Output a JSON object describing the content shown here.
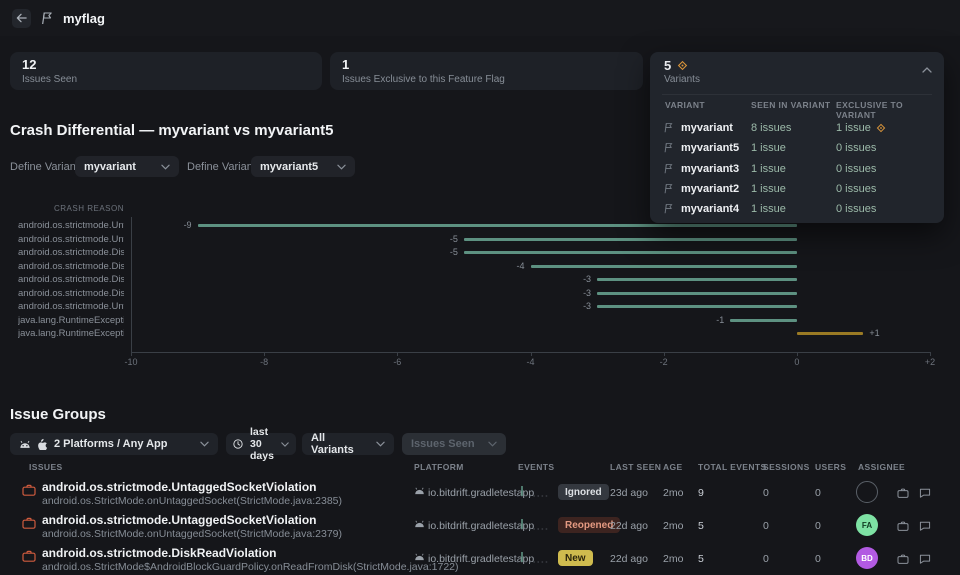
{
  "topbar": {
    "title": "myflag",
    "back_icon": "arrow-left-icon",
    "title_icon": "flag-icon"
  },
  "stat_cards": [
    {
      "value": "12",
      "label": "Issues Seen"
    },
    {
      "value": "1",
      "label": "Issues Exclusive to this Feature Flag"
    }
  ],
  "variants_panel": {
    "value": "5",
    "label": "Variants",
    "badge_icon": "diamond-icon",
    "collapse_icon": "chevron-up-icon",
    "columns": [
      "VARIANT",
      "SEEN IN VARIANT",
      "EXCLUSIVE TO VARIANT"
    ],
    "rows": [
      {
        "name": "myvariant",
        "seen": "8 issues",
        "exclusive": "1 issue",
        "exclusive_badge": true
      },
      {
        "name": "myvariant5",
        "seen": "1 issue",
        "exclusive": "0 issues",
        "exclusive_badge": false
      },
      {
        "name": "myvariant3",
        "seen": "1 issue",
        "exclusive": "0 issues",
        "exclusive_badge": false
      },
      {
        "name": "myvariant2",
        "seen": "1 issue",
        "exclusive": "0 issues",
        "exclusive_badge": false
      },
      {
        "name": "myvariant4",
        "seen": "1 issue",
        "exclusive": "0 issues",
        "exclusive_badge": false
      }
    ]
  },
  "crash_differential": {
    "title": "Crash Differential — myvariant vs myvariant5",
    "variant_a_label": "Define Variant A",
    "variant_a_value": "myvariant",
    "variant_b_label": "Define Variant B",
    "variant_b_value": "myvariant5"
  },
  "chart_data": {
    "type": "bar",
    "orientation": "horizontal",
    "axis_label": "CRASH REASON",
    "categories": [
      "android.os.strictmode.Untag…",
      "android.os.strictmode.Untag…",
      "android.os.strictmode.DiskR…",
      "android.os.strictmode.DiskR…",
      "android.os.strictmode.DiskR…",
      "android.os.strictmode.DiskR…",
      "android.os.strictmode.Untag…",
      "java.lang.RuntimeException…",
      "java.lang.RuntimeException…"
    ],
    "values": [
      -9,
      -5,
      -5,
      -4,
      -3,
      -3,
      -3,
      -1,
      1
    ],
    "value_labels": [
      "-9",
      "-5",
      "-5",
      "-4",
      "-3",
      "-3",
      "-3",
      "-1",
      "+1"
    ],
    "xlim": [
      -10,
      2
    ],
    "x_ticks": [
      "-10",
      "-8",
      "-6",
      "-4",
      "-2",
      "0",
      "+2"
    ],
    "x_tick_values": [
      -10,
      -8,
      -6,
      -4,
      -2,
      0,
      2
    ],
    "grid": false,
    "colors": {
      "negative": "#5d9181",
      "positive": "#9a7a24"
    }
  },
  "issue_groups": {
    "title": "Issue Groups",
    "filters": [
      {
        "label": "2 Platforms / Any App",
        "icons": [
          "android-icon",
          "apple-icon"
        ],
        "disabled": false
      },
      {
        "label": "last 30 days",
        "icons": [
          "clock-icon"
        ],
        "disabled": false
      },
      {
        "label": "All Variants",
        "icons": [],
        "disabled": false
      },
      {
        "label": "Issues Seen",
        "icons": [],
        "disabled": true
      }
    ],
    "columns": [
      "ISSUES",
      "PLATFORM",
      "EVENTS",
      "LAST SEEN",
      "AGE",
      "TOTAL EVENTS",
      "SESSIONS",
      "USERS",
      "ASSIGNEE"
    ],
    "rows": [
      {
        "title": "android.os.strictmode.UntaggedSocketViolation",
        "subtitle": "android.os.StrictMode.onUntaggedSocket(StrictMode.java:2385)",
        "platform": "io.bitdrift.gradletestapp",
        "status": "Ignored",
        "status_type": "ignored",
        "last_seen": "23d ago",
        "age": "2mo",
        "total_events": "9",
        "sessions": "0",
        "users": "0",
        "assignee": "",
        "assignee_bg": "",
        "assignee_fg": ""
      },
      {
        "title": "android.os.strictmode.UntaggedSocketViolation",
        "subtitle": "android.os.StrictMode.onUntaggedSocket(StrictMode.java:2379)",
        "platform": "io.bitdrift.gradletestapp",
        "status": "Reopened",
        "status_type": "reopened",
        "last_seen": "22d ago",
        "age": "2mo",
        "total_events": "5",
        "sessions": "0",
        "users": "0",
        "assignee": "FA",
        "assignee_bg": "#7ee2a4",
        "assignee_fg": "#103b22"
      },
      {
        "title": "android.os.strictmode.DiskReadViolation",
        "subtitle": "android.os.StrictMode$AndroidBlockGuardPolicy.onReadFromDisk(StrictMode.java:1722)",
        "platform": "io.bitdrift.gradletestapp",
        "status": "New",
        "status_type": "new",
        "last_seen": "22d ago",
        "age": "2mo",
        "total_events": "5",
        "sessions": "0",
        "users": "0",
        "assignee": "BD",
        "assignee_bg": "#b25ae2",
        "assignee_fg": "#ffffff"
      }
    ]
  },
  "colors": {
    "background": "#15161a",
    "card": "#1e2127",
    "panel": "#21252c",
    "link_green": "#9cbaa9",
    "bar_negative": "#5d9181",
    "bar_positive": "#9a7a24",
    "diamond_orange": "#d9953b",
    "issue_icon_orange": "#cf5b3e"
  }
}
